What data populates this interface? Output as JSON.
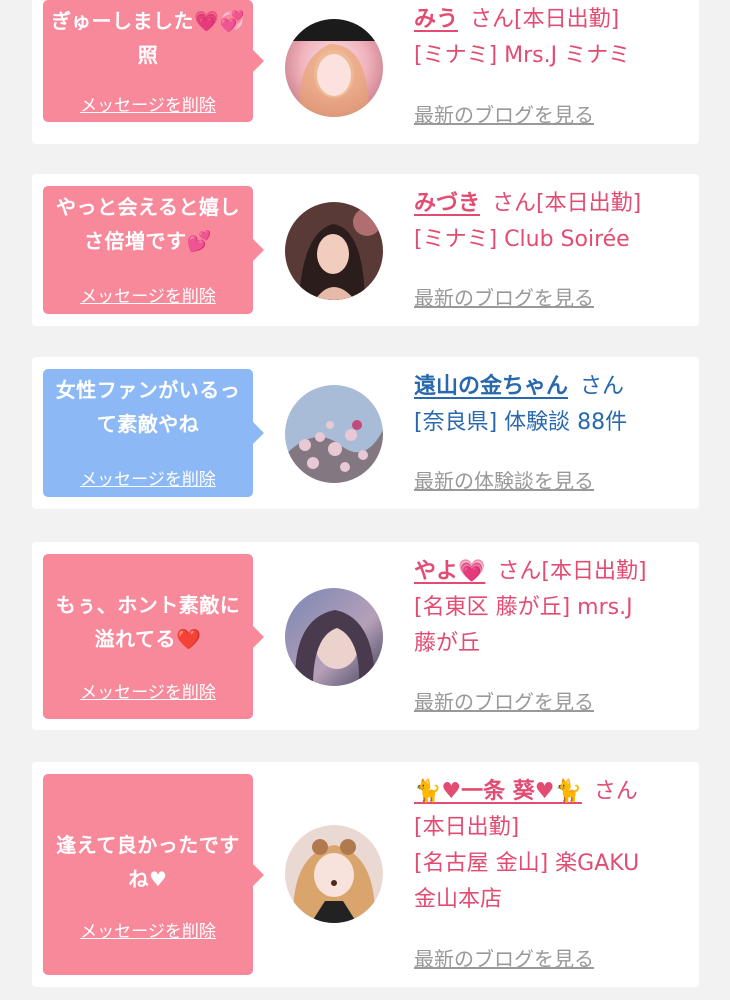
{
  "cards": [
    {
      "message": "ぎゅーしました💗💞照",
      "delete_label": "メッセージを削除",
      "name": "みう",
      "san": "さん[本日出勤]",
      "tags": [
        "[ミナミ] Mrs.J ミナミ"
      ],
      "latest_label": "最新のブログを見る",
      "theme": "pink"
    },
    {
      "message": "やっと会えると嬉しさ倍増です💕",
      "delete_label": "メッセージを削除",
      "name": "みづき",
      "san": "さん[本日出勤]",
      "tags": [
        "[ミナミ] Club Soirée"
      ],
      "latest_label": "最新のブログを見る",
      "theme": "pink"
    },
    {
      "message": "女性ファンがいるって素敵やね",
      "delete_label": "メッセージを削除",
      "name": "遠山の金ちゃん",
      "san": "さん",
      "tags": [
        "[奈良県] 体験談 88件"
      ],
      "latest_label": "最新の体験談を見る",
      "theme": "blue"
    },
    {
      "message": "もぅ、ホント素敵に溢れてる❤️",
      "delete_label": "メッセージを削除",
      "name": "やよ💗",
      "san": "さん[本日出勤]",
      "tags": [
        "[名東区 藤が丘] mrs.J",
        "藤が丘"
      ],
      "latest_label": "最新のブログを見る",
      "theme": "pink"
    },
    {
      "message": "逢えて良かったですね♥",
      "delete_label": "メッセージを削除",
      "name": "🐈♥一条 葵♥🐈",
      "san": "さん",
      "tags": [
        "[本日出勤]",
        "[名古屋 金山] 楽GAKU",
        "金山本店"
      ],
      "latest_label": "最新のブログを見る",
      "theme": "pink"
    }
  ],
  "colors": {
    "pink_bubble": "#f7899b",
    "blue_bubble": "#8cb9f5",
    "pink_text": "#e34c72",
    "blue_text": "#2868ad",
    "link_gray": "#999999"
  }
}
